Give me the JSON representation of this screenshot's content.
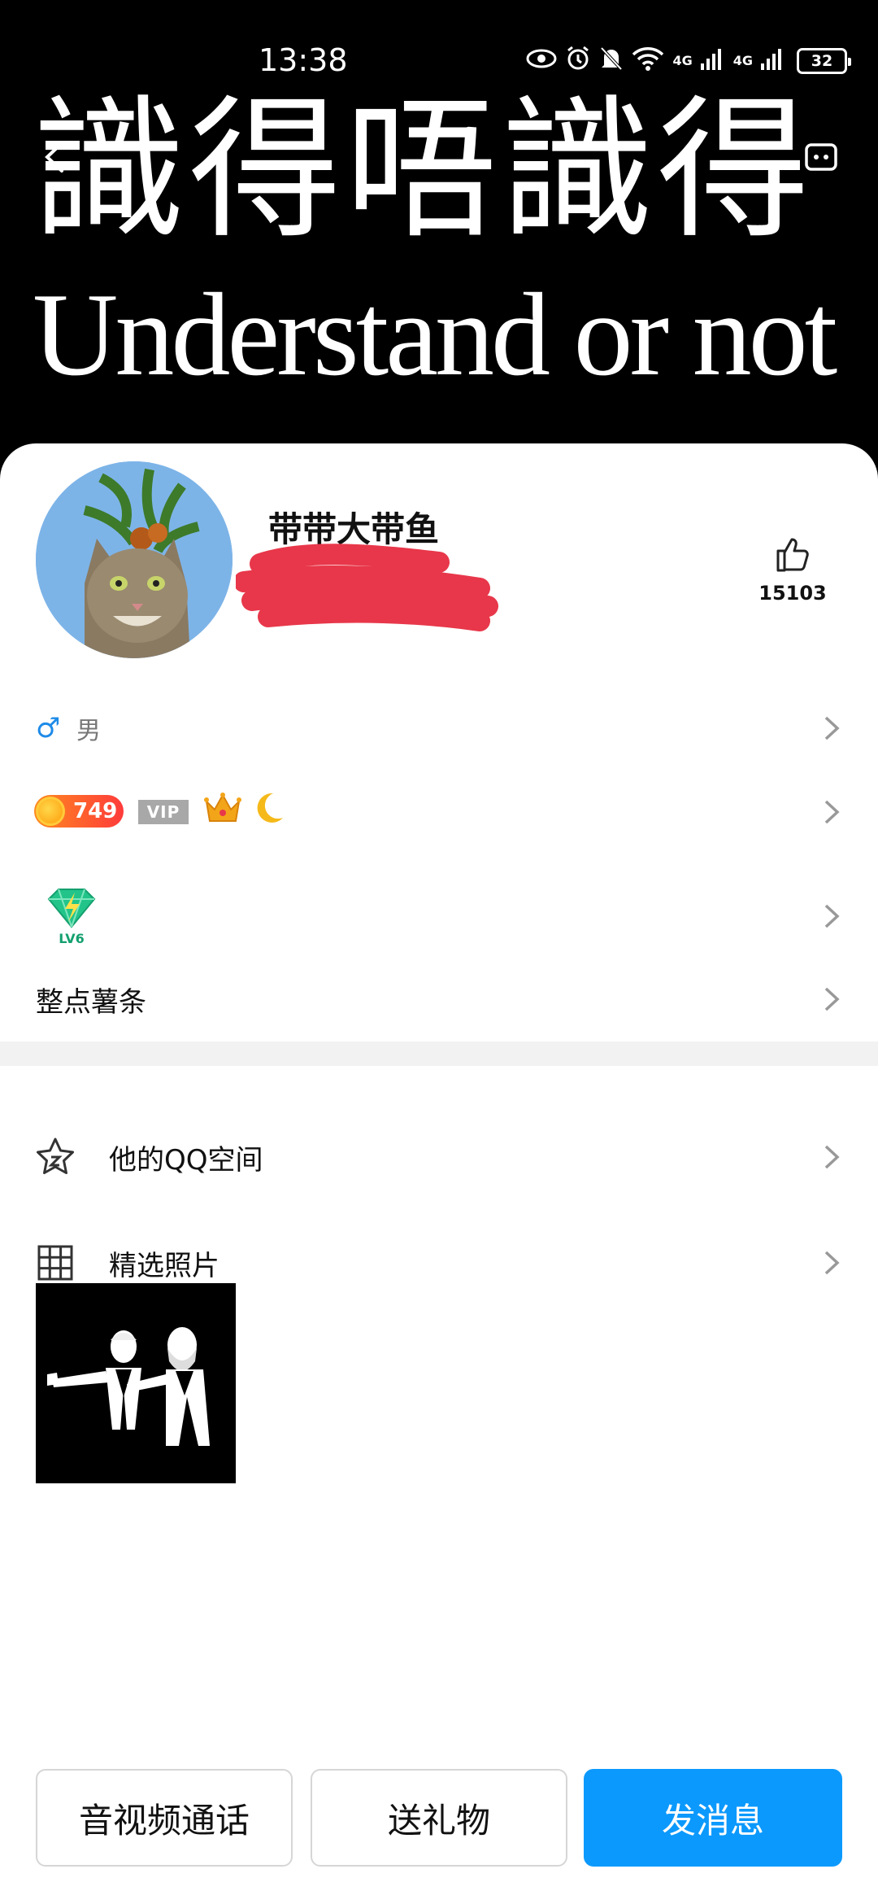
{
  "status_bar": {
    "time": "13:38",
    "network_labels": [
      "4G",
      "4G"
    ],
    "battery": "32",
    "icons": [
      "eye-icon",
      "alarm-icon",
      "mute-bell-icon",
      "wifi-icon",
      "signal-icon",
      "signal-icon",
      "battery-icon"
    ]
  },
  "cover": {
    "title_cn": "識得唔識得",
    "title_en": "Understand or not"
  },
  "profile": {
    "nickname": "带带大带鱼",
    "likes": "15103",
    "gender": "男",
    "gender_symbol": "♂",
    "coin_level": "749",
    "vip_label": "VIP",
    "level_badge": "LV6"
  },
  "rows": {
    "text_label": "整点薯条"
  },
  "menu": {
    "zone_label": "他的QQ空间",
    "photos_label": "精选照片"
  },
  "actions": {
    "call": "音视频通话",
    "gift": "送礼物",
    "message": "发消息"
  },
  "colors": {
    "accent": "#0c99fd",
    "redaction": "#e8374a",
    "gender": "#1e8be8"
  }
}
